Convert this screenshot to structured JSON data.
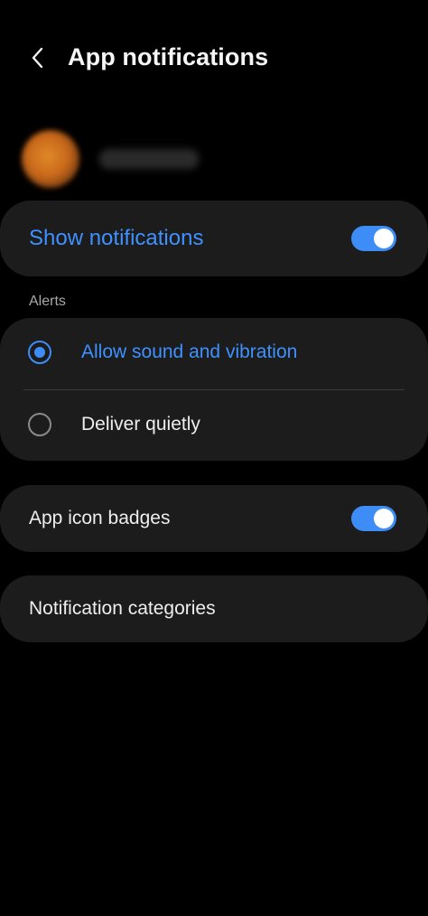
{
  "header": {
    "title": "App notifications",
    "back_icon": "chevron-left-icon"
  },
  "app": {
    "icon": "blurred-app-icon",
    "name": ""
  },
  "show_notifications": {
    "label": "Show notifications",
    "enabled": true
  },
  "alerts": {
    "section_label": "Alerts",
    "options": [
      {
        "label": "Allow sound and vibration",
        "selected": true
      },
      {
        "label": "Deliver quietly",
        "selected": false
      }
    ]
  },
  "app_icon_badges": {
    "label": "App icon badges",
    "enabled": true
  },
  "notification_categories": {
    "label": "Notification categories"
  },
  "colors": {
    "accent": "#3e8df7",
    "card_background": "#1c1c1c",
    "page_background": "#000000"
  }
}
